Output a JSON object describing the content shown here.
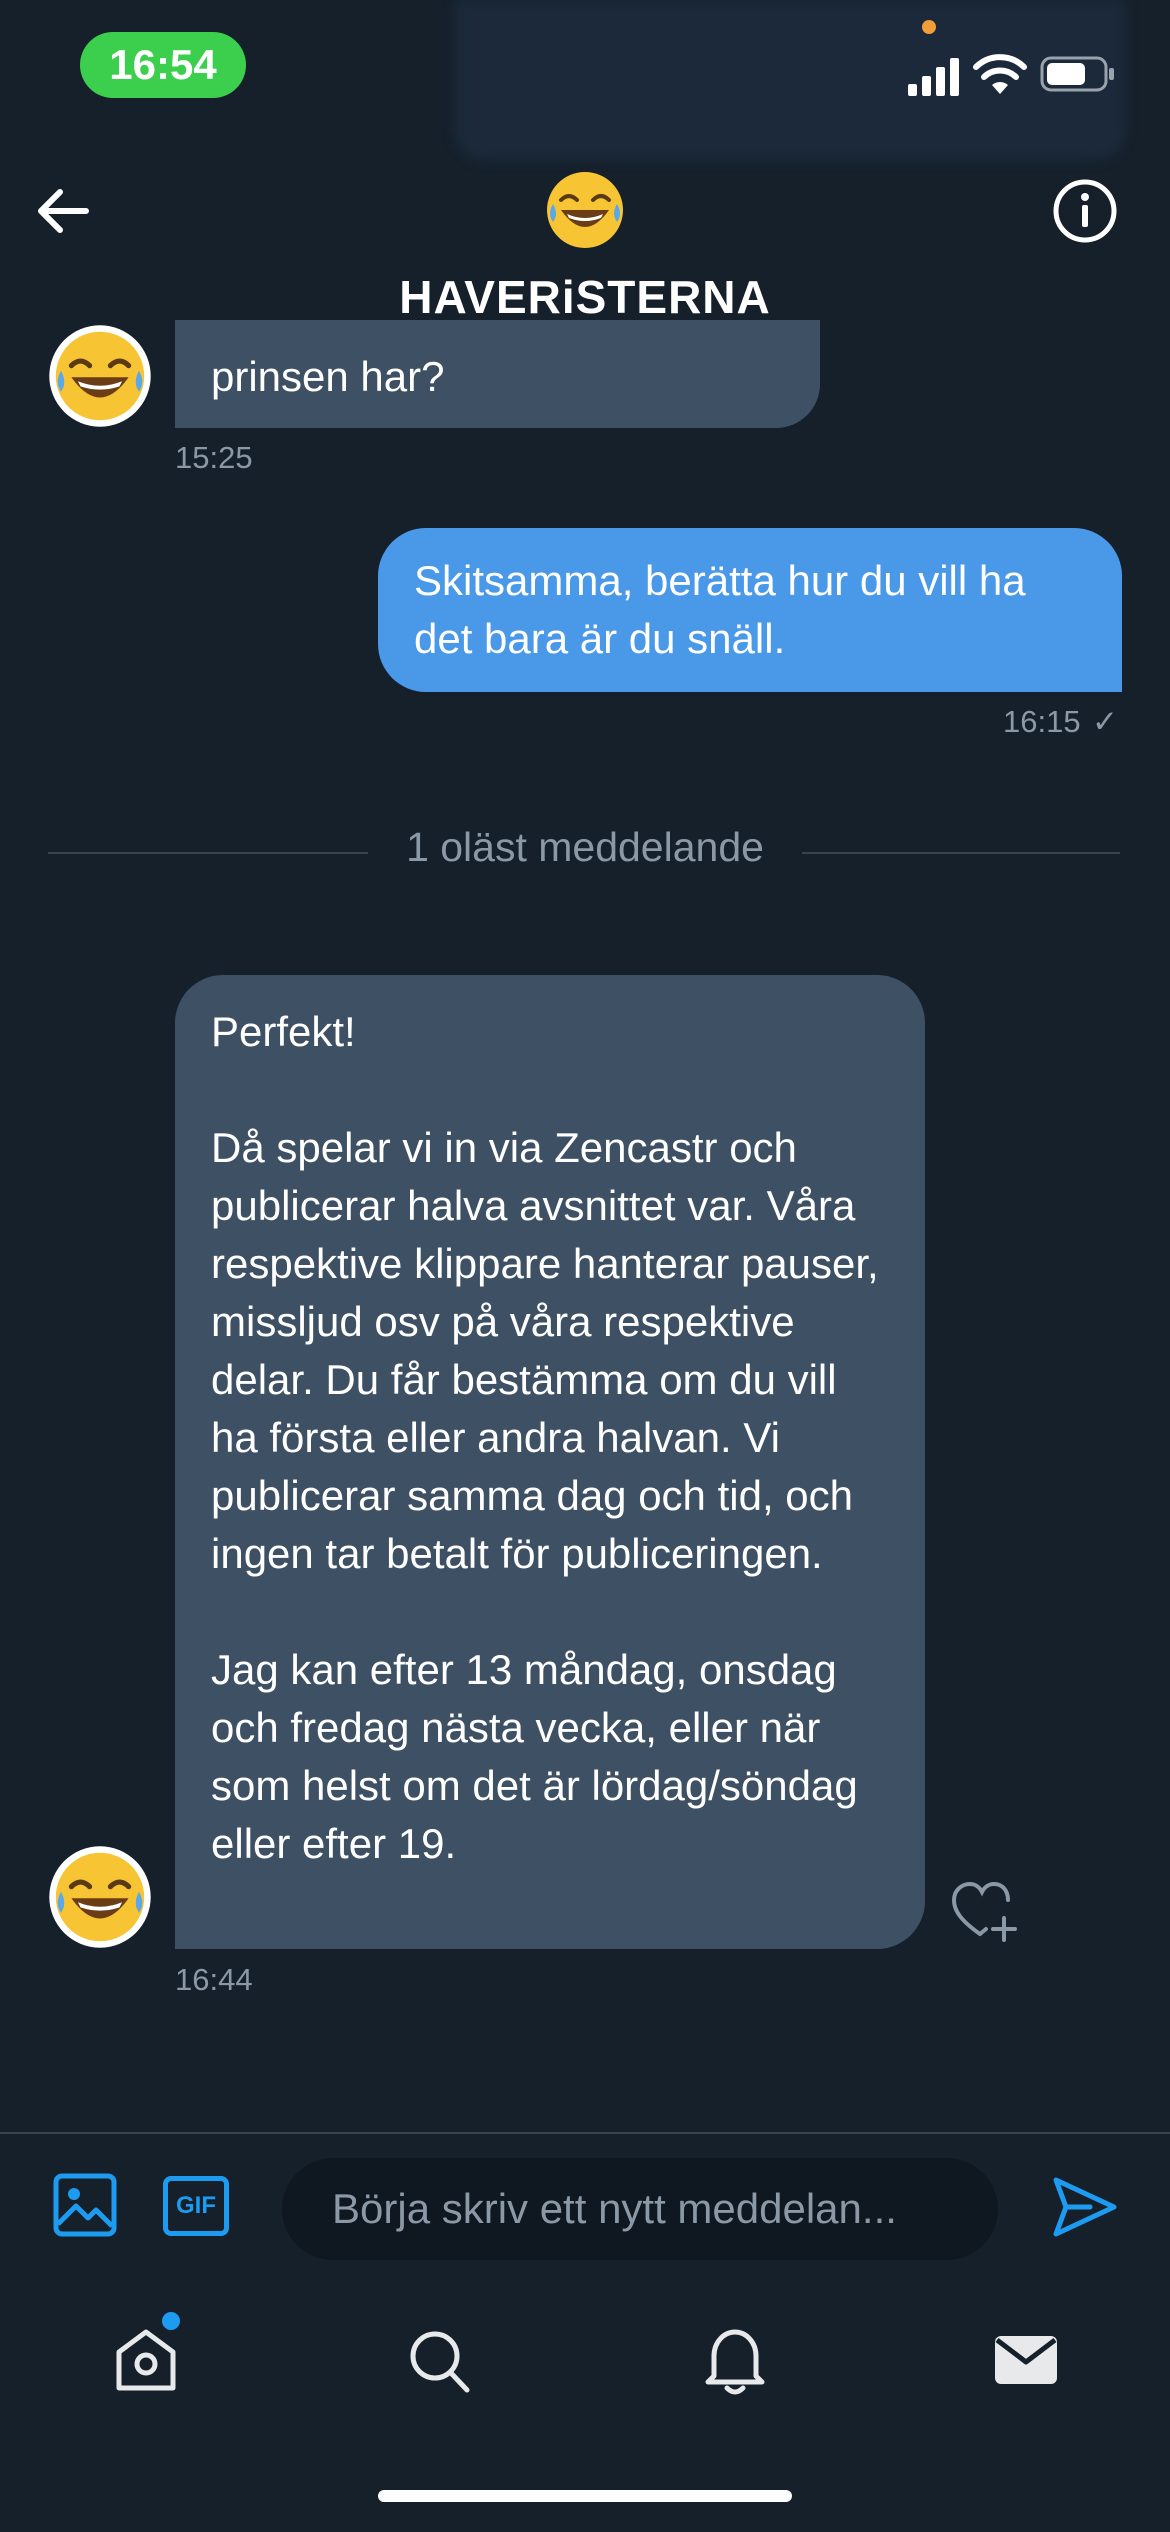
{
  "status_bar": {
    "time": "16:54"
  },
  "header": {
    "title": "HAVERiSTERNA",
    "avatar_icon": "tears-of-joy-emoji"
  },
  "messages": [
    {
      "direction": "in",
      "text": "prinsen har?",
      "time": "15:25"
    },
    {
      "direction": "out",
      "text": "Skitsamma, berätta hur du vill ha det bara är du snäll.",
      "time": "16:15",
      "read_mark": "✓"
    },
    {
      "direction": "in",
      "text": "Perfekt!\n\nDå spelar vi in via Zencastr och publicerar halva avsnittet var. Våra respektive klippare hanterar pauser, missljud osv på våra respektive delar. Du får bestämma om du vill ha första eller andra halvan. Vi publicerar samma dag och tid, och ingen tar betalt för publiceringen.\n\nJag kan efter 13 måndag, onsdag och fredag nästa vecka, eller när som helst om det är lördag/söndag eller efter 19.",
      "time": "16:44"
    }
  ],
  "unread_divider": "1 oläst meddelande",
  "composer": {
    "placeholder": "Börja skriv ett nytt meddelan...",
    "gif_label": "GIF"
  },
  "tabs": [
    "home-icon",
    "search-icon",
    "bell-icon",
    "mail-icon"
  ],
  "colors": {
    "background": "#15202b",
    "incoming_bubble": "#3e5064",
    "outgoing_bubble": "#4a99e9",
    "accent": "#1d9bf0",
    "muted_text": "#8b98a5"
  }
}
